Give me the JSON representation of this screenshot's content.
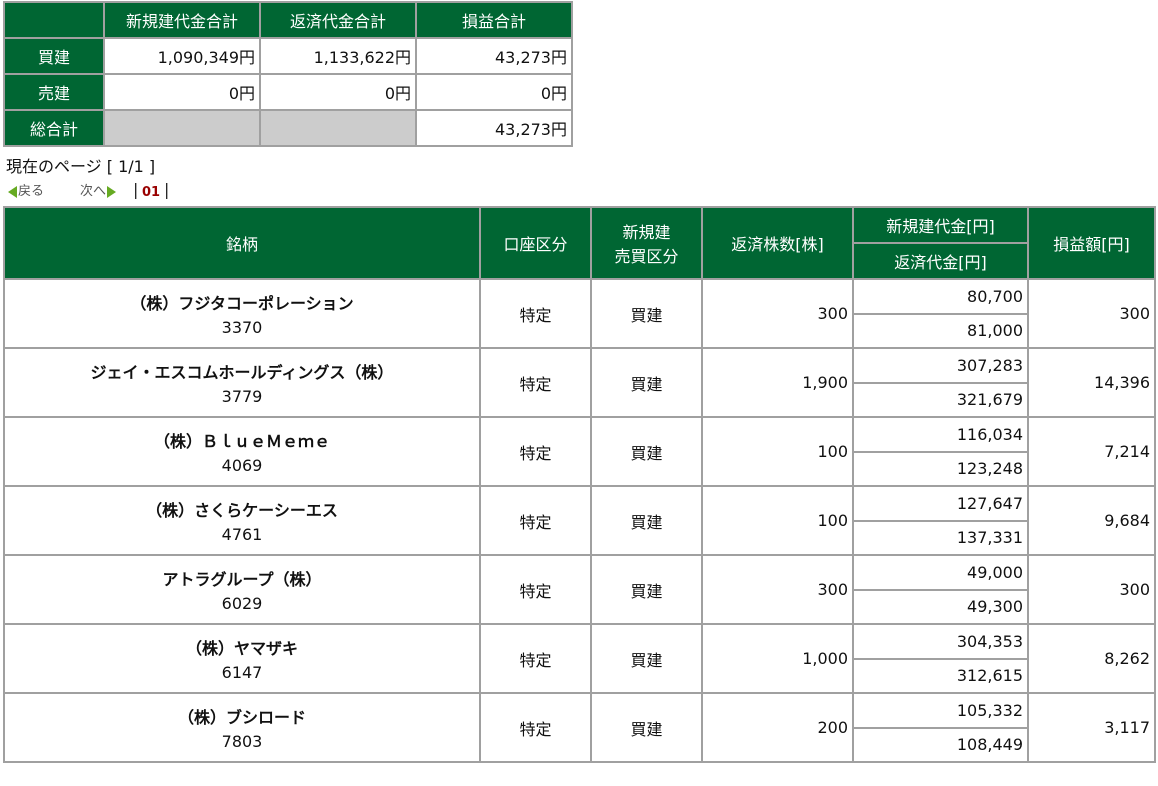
{
  "summary": {
    "headers": [
      "新規建代金合計",
      "返済代金合計",
      "損益合計"
    ],
    "rows": [
      {
        "label": "買建",
        "new_amount": "1,090,349円",
        "close_amount": "1,133,622円",
        "pl": "43,273円"
      },
      {
        "label": "売建",
        "new_amount": "0円",
        "close_amount": "0円",
        "pl": "0円"
      }
    ],
    "total": {
      "label": "総合計",
      "pl": "43,273円"
    }
  },
  "pager": {
    "info": "現在のページ [ 1/1 ]",
    "prev": "戻る",
    "next": "次へ",
    "page": "01",
    "separator": "|"
  },
  "positions": {
    "headers": {
      "stock": "銘柄",
      "account": "口座区分",
      "side_line1": "新規建",
      "side_line2": "売買区分",
      "qty": "返済株数[株]",
      "new_amount": "新規建代金[円]",
      "close_amount": "返済代金[円]",
      "pl": "損益額[円]"
    },
    "rows": [
      {
        "name": "（株）フジタコーポレーション",
        "code": "3370",
        "account": "特定",
        "side": "買建",
        "qty": "300",
        "new_amount": "80,700",
        "close_amount": "81,000",
        "pl": "300"
      },
      {
        "name": "ジェイ・エスコムホールディングス（株）",
        "code": "3779",
        "account": "特定",
        "side": "買建",
        "qty": "1,900",
        "new_amount": "307,283",
        "close_amount": "321,679",
        "pl": "14,396"
      },
      {
        "name": "（株）ＢｌｕｅＭｅｍｅ",
        "code": "4069",
        "account": "特定",
        "side": "買建",
        "qty": "100",
        "new_amount": "116,034",
        "close_amount": "123,248",
        "pl": "7,214"
      },
      {
        "name": "（株）さくらケーシーエス",
        "code": "4761",
        "account": "特定",
        "side": "買建",
        "qty": "100",
        "new_amount": "127,647",
        "close_amount": "137,331",
        "pl": "9,684"
      },
      {
        "name": "アトラグループ（株）",
        "code": "6029",
        "account": "特定",
        "side": "買建",
        "qty": "300",
        "new_amount": "49,000",
        "close_amount": "49,300",
        "pl": "300"
      },
      {
        "name": "（株）ヤマザキ",
        "code": "6147",
        "account": "特定",
        "side": "買建",
        "qty": "1,000",
        "new_amount": "304,353",
        "close_amount": "312,615",
        "pl": "8,262"
      },
      {
        "name": "（株）ブシロード",
        "code": "7803",
        "account": "特定",
        "side": "買建",
        "qty": "200",
        "new_amount": "105,332",
        "close_amount": "108,449",
        "pl": "3,117"
      }
    ]
  },
  "colors": {
    "header_green": "#006633",
    "arrow_green": "#66aa22",
    "page_number": "#990000"
  }
}
